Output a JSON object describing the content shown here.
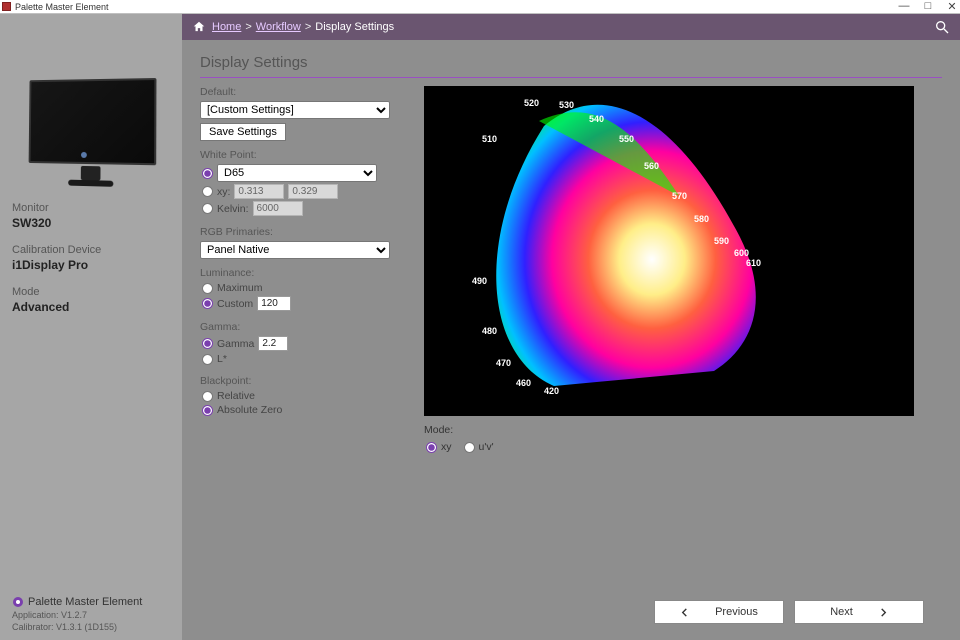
{
  "window_title": "Palette Master Element",
  "breadcrumb": {
    "home": "Home",
    "workflow": "Workflow",
    "current": "Display Settings"
  },
  "page_title": "Display Settings",
  "sidebar": {
    "monitor_label": "Monitor",
    "monitor_value": "SW320",
    "device_label": "Calibration Device",
    "device_value": "i1Display Pro",
    "mode_label": "Mode",
    "mode_value": "Advanced",
    "brand": "Palette Master Element",
    "app_version": "Application: V1.2.7",
    "cal_version": "Calibrator: V1.3.1 (1D155)"
  },
  "defaults": {
    "label": "Default:",
    "selected": "[Custom Settings]",
    "save_btn": "Save Settings"
  },
  "white_point": {
    "label": "White Point:",
    "preset_selected": "D65",
    "xy_label": "xy:",
    "x_val": "0.313",
    "y_val": "0.329",
    "kelvin_label": "Kelvin:",
    "kelvin_val": "6000"
  },
  "primaries": {
    "label": "RGB Primaries:",
    "selected": "Panel Native"
  },
  "luminance": {
    "label": "Luminance:",
    "max_label": "Maximum",
    "custom_label": "Custom",
    "custom_val": "120"
  },
  "gamma": {
    "label": "Gamma:",
    "gamma_label": "Gamma",
    "gamma_val": "2.2",
    "lstar_label": "L*"
  },
  "blackpoint": {
    "label": "Blackpoint:",
    "relative": "Relative",
    "absolute": "Absolute Zero"
  },
  "diagram": {
    "mode_label": "Mode:",
    "xy": "xy",
    "uv": "u'v'",
    "wavelengths": [
      "520",
      "530",
      "540",
      "550",
      "560",
      "570",
      "580",
      "590",
      "600",
      "610",
      "510",
      "490",
      "480",
      "470",
      "460",
      "420"
    ]
  },
  "nav": {
    "previous": "Previous",
    "next": "Next"
  }
}
